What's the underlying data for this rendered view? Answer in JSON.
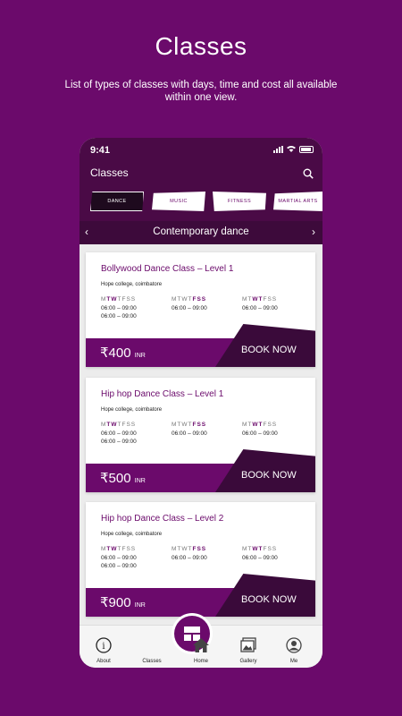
{
  "hero": {
    "title": "Classes",
    "subtitle": "List of types of classes with days, time and cost all available within one view."
  },
  "status": {
    "time": "9:41"
  },
  "app": {
    "title": "Classes"
  },
  "tabs": [
    {
      "label": "DANCE",
      "active": true
    },
    {
      "label": "MUSIC",
      "active": false
    },
    {
      "label": "FITNESS",
      "active": false
    },
    {
      "label": "MARTIAL ARTS",
      "active": false
    }
  ],
  "category": {
    "label": "Contemporary dance"
  },
  "days_template": "MTWTFSS",
  "cards": [
    {
      "title": "Bollywood Dance Class – Level 1",
      "location": "Hope college, coimbatore",
      "schedules": [
        {
          "times": [
            "06:00 – 09:00",
            "06:00 – 09:00"
          ]
        },
        {
          "times": [
            "06:00 – 09:00"
          ]
        },
        {
          "times": [
            "06:00 – 09:00"
          ]
        }
      ],
      "price": "₹400",
      "currency": "INR",
      "cta": "BOOK NOW"
    },
    {
      "title": "Hip hop Dance Class – Level 1",
      "location": "Hope college, coimbatore",
      "schedules": [
        {
          "times": [
            "06:00 – 09:00",
            "06:00 – 09:00"
          ]
        },
        {
          "times": [
            "06:00 – 09:00"
          ]
        },
        {
          "times": [
            "06:00 – 09:00"
          ]
        }
      ],
      "price": "₹500",
      "currency": "INR",
      "cta": "BOOK NOW"
    },
    {
      "title": "Hip hop Dance Class – Level 2",
      "location": "Hope college, coimbatore",
      "schedules": [
        {
          "times": [
            "06:00 – 09:00",
            "06:00 – 09:00"
          ]
        },
        {
          "times": [
            "06:00 – 09:00"
          ]
        },
        {
          "times": [
            "06:00 – 09:00"
          ]
        }
      ],
      "price": "₹900",
      "currency": "INR",
      "cta": "BOOK NOW"
    }
  ],
  "nav": [
    {
      "label": "About",
      "icon": "info-icon"
    },
    {
      "label": "Classes",
      "icon": "classes-icon",
      "active": true
    },
    {
      "label": "Home",
      "icon": "home-icon"
    },
    {
      "label": "Gallery",
      "icon": "gallery-icon"
    },
    {
      "label": "Me",
      "icon": "profile-icon"
    }
  ],
  "colors": {
    "brand": "#6b0a6b",
    "dark": "#3a0a3a"
  }
}
